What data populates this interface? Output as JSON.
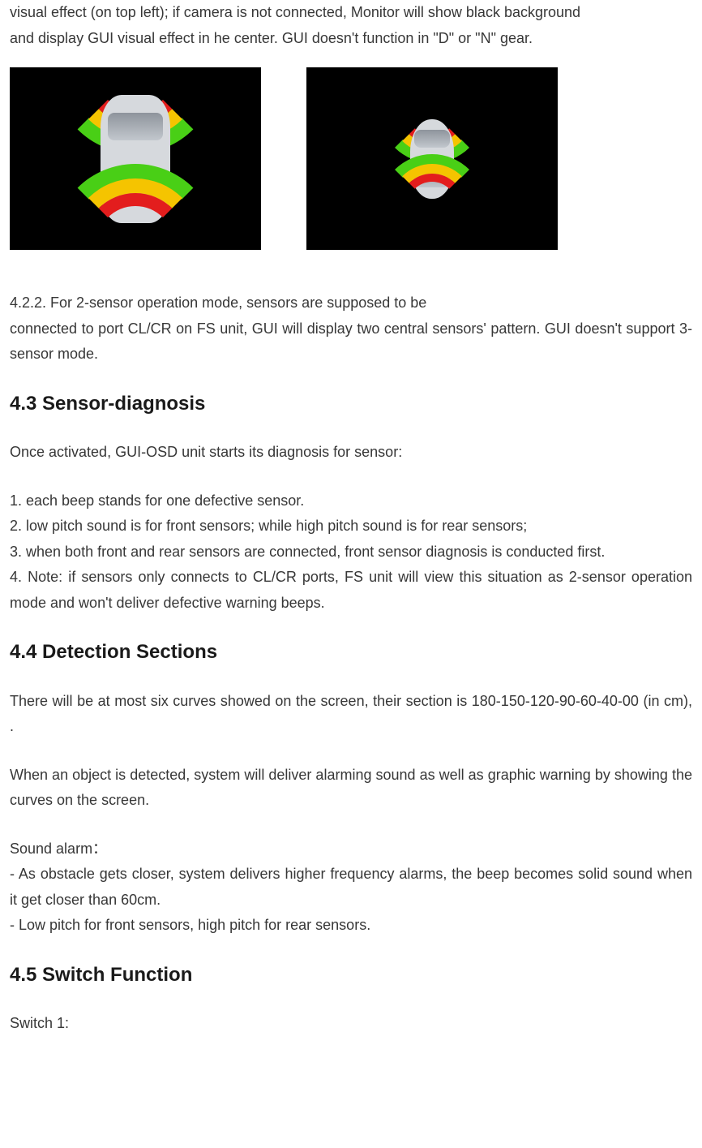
{
  "intro": {
    "line1": "visual effect (on top left); if camera is not connected, Monitor will show black background",
    "line2": "and display GUI visual effect in he center. GUI doesn't function in \"D\" or \"N\" gear."
  },
  "section_422": {
    "line1": "4.2.2. For 2-sensor operation mode, sensors are supposed to be",
    "line2": "connected to port CL/CR on FS unit, GUI will display two central sensors' pattern. GUI doesn't support 3-sensor mode."
  },
  "section_43": {
    "heading": "4.3 Sensor-diagnosis",
    "intro": "Once activated, GUI-OSD unit starts its diagnosis for sensor:",
    "item1": "1. each beep stands for one defective sensor.",
    "item2": "2. low pitch sound is for front sensors; while high pitch sound is for rear sensors;",
    "item3": "3. when both front and rear sensors are connected, front sensor diagnosis is conducted first.",
    "item4": "4. Note: if sensors only connects to CL/CR ports, FS unit will view this situation as 2-sensor operation mode and won't deliver defective warning beeps."
  },
  "section_44": {
    "heading": "4.4 Detection Sections",
    "p1": "There will be at most six curves showed on the screen, their section is 180-150-120-90-60-40-00 (in cm), .",
    "p2": "When an object is detected, system will deliver alarming sound as well as graphic warning by showing the curves on the screen.",
    "sound_label": "Sound alarm：",
    "sound1": "- As obstacle gets closer, system delivers higher frequency alarms, the beep becomes solid sound when it get closer than 60cm.",
    "sound2": "- Low pitch for front sensors, high pitch for rear sensors."
  },
  "section_45": {
    "heading": "4.5 Switch Function",
    "switch1": "Switch 1:"
  }
}
